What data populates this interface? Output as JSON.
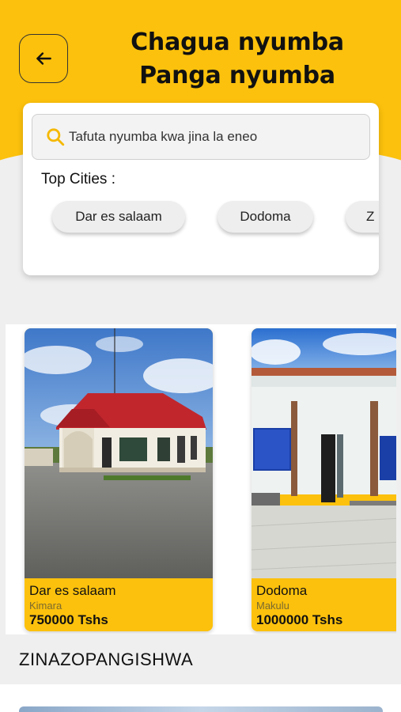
{
  "header": {
    "title_line1": "Chagua nyumba",
    "title_line2": "Panga nyumba",
    "back_icon": "arrow-left-icon",
    "bg_color": "#fcc10c"
  },
  "search": {
    "placeholder": "Tafuta nyumba kwa jina la eneo",
    "value": "",
    "icon": "search-icon",
    "icon_color": "#f5b800"
  },
  "top_cities": {
    "label": "Top Cities :",
    "items": [
      "Dar es salaam",
      "Dodoma",
      "Z"
    ]
  },
  "listings": [
    {
      "city": "Dar es salaam",
      "area": "Kimara",
      "price": "750000 Tshs"
    },
    {
      "city": "Dodoma",
      "area": "Makulu",
      "price": "1000000 Tshs"
    }
  ],
  "section": {
    "title": "ZINAZOPANGISHWA"
  }
}
